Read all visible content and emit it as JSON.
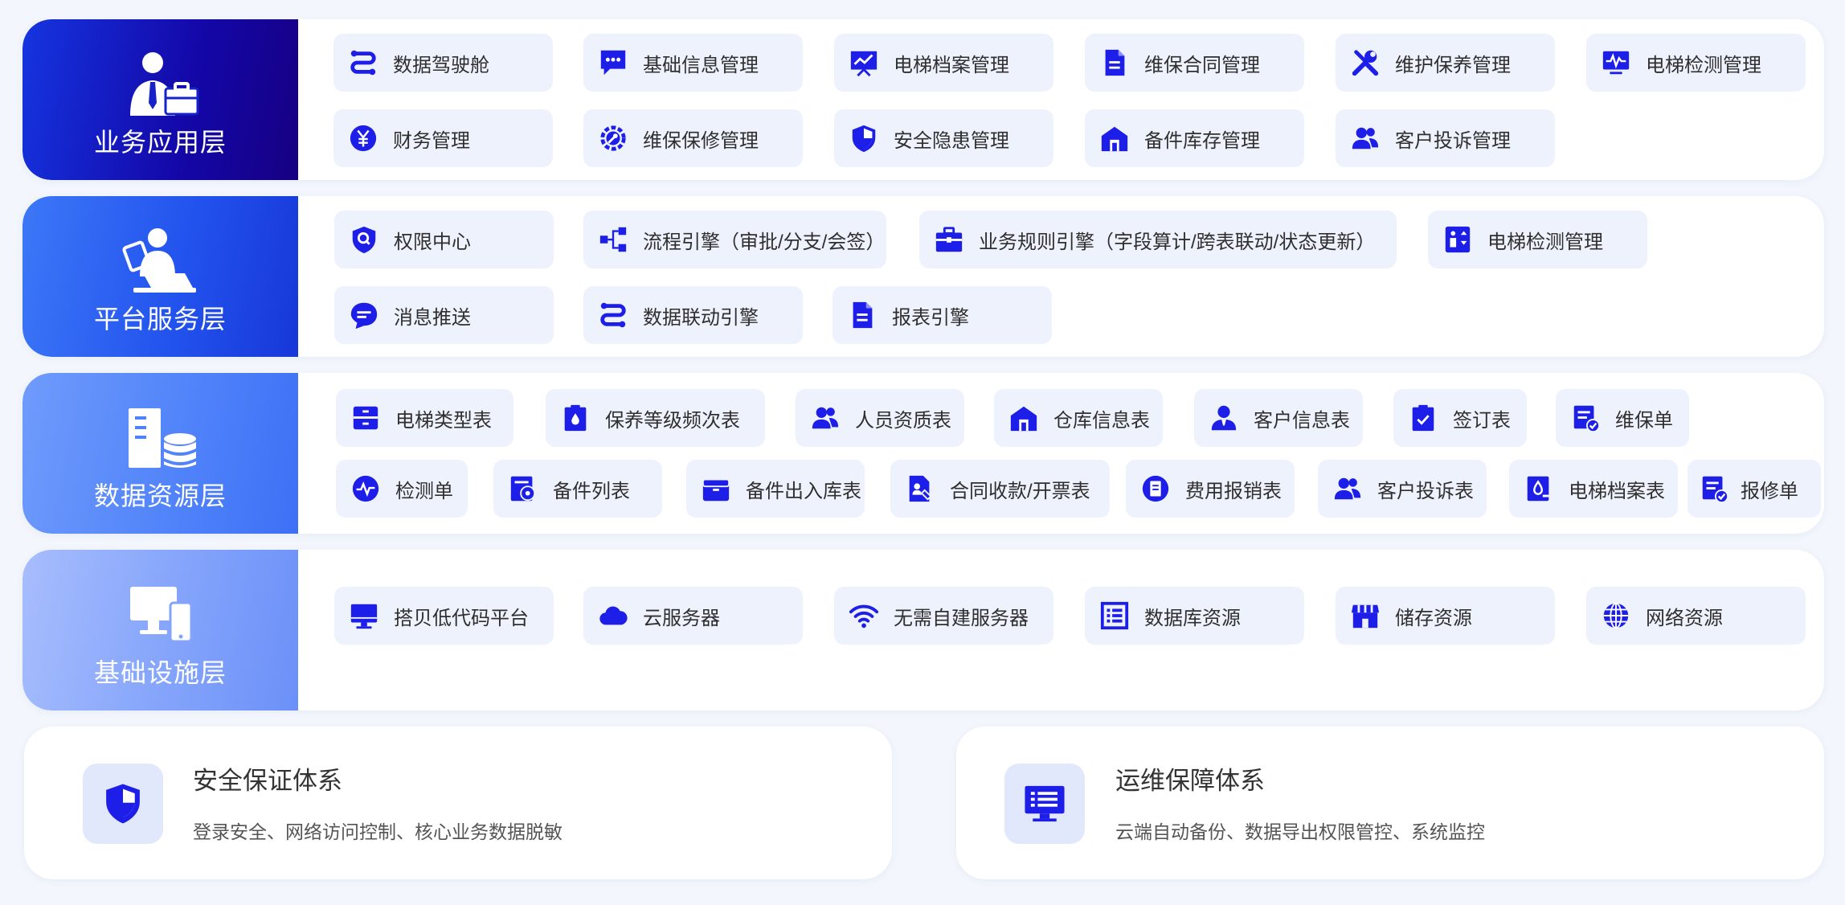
{
  "colors": {
    "accent": "#1d1ee8",
    "pill_bg": "#eef2fd",
    "page_bg": "#f3f6fc"
  },
  "layers": [
    {
      "label": "业务应用层",
      "items": [
        {
          "label": "数据驾驶舱",
          "icon": "route-icon"
        },
        {
          "label": "基础信息管理",
          "icon": "chat-dots-icon"
        },
        {
          "label": "电梯档案管理",
          "icon": "presentation-chart-icon"
        },
        {
          "label": "维保合同管理",
          "icon": "document-icon"
        },
        {
          "label": "维护保养管理",
          "icon": "tools-icon"
        },
        {
          "label": "电梯检测管理",
          "icon": "monitor-pulse-icon"
        },
        {
          "label": "财务管理",
          "icon": "yen-circle-icon"
        },
        {
          "label": "维保保修管理",
          "icon": "wrench-gear-icon"
        },
        {
          "label": "安全隐患管理",
          "icon": "shield-icon"
        },
        {
          "label": "备件库存管理",
          "icon": "warehouse-icon"
        },
        {
          "label": "客户投诉管理",
          "icon": "users-icon"
        }
      ]
    },
    {
      "label": "平台服务层",
      "items": [
        {
          "label": "权限中心",
          "icon": "shield-search-icon"
        },
        {
          "label": "流程引擎（审批/分支/会签）",
          "icon": "flow-branch-icon"
        },
        {
          "label": "业务规则引擎（字段算计/跨表联动/状态更新）",
          "icon": "briefcase-icon"
        },
        {
          "label": "电梯检测管理",
          "icon": "elevator-icon"
        },
        {
          "label": "消息推送",
          "icon": "message-bubble-icon"
        },
        {
          "label": "数据联动引擎",
          "icon": "route-icon"
        },
        {
          "label": "报表引擎",
          "icon": "document-icon"
        }
      ]
    },
    {
      "label": "数据资源层",
      "items": [
        {
          "label": "电梯类型表",
          "icon": "cabinet-icon"
        },
        {
          "label": "保养等级频次表",
          "icon": "clipboard-drop-icon"
        },
        {
          "label": "人员资质表",
          "icon": "users-icon"
        },
        {
          "label": "仓库信息表",
          "icon": "warehouse-icon"
        },
        {
          "label": "客户信息表",
          "icon": "customer-icon"
        },
        {
          "label": "签订表",
          "icon": "clipboard-check-icon"
        },
        {
          "label": "维保单",
          "icon": "form-check-icon"
        },
        {
          "label": "检测单",
          "icon": "pulse-circle-icon"
        },
        {
          "label": "备件列表",
          "icon": "parts-list-icon"
        },
        {
          "label": "备件出入库表",
          "icon": "box-icon"
        },
        {
          "label": "合同收款/开票表",
          "icon": "contract-icon"
        },
        {
          "label": "费用报销表",
          "icon": "receipt-circle-icon"
        },
        {
          "label": "客户投诉表",
          "icon": "users-icon"
        },
        {
          "label": "电梯档案表",
          "icon": "archive-icon"
        },
        {
          "label": "报修单",
          "icon": "form-check-icon"
        }
      ]
    },
    {
      "label": "基础设施层",
      "items": [
        {
          "label": "搭贝低代码平台",
          "icon": "desktop-icon"
        },
        {
          "label": "云服务器",
          "icon": "cloud-icon"
        },
        {
          "label": "无需自建服务器",
          "icon": "wifi-icon"
        },
        {
          "label": "数据库资源",
          "icon": "list-box-icon"
        },
        {
          "label": "储存资源",
          "icon": "store-icon"
        },
        {
          "label": "网络资源",
          "icon": "globe-icon"
        }
      ]
    }
  ],
  "bottom": [
    {
      "title": "安全保证体系",
      "desc": "登录安全、网络访问控制、核心业务数据脱敏",
      "icon": "shield-icon"
    },
    {
      "title": "运维保障体系",
      "desc": "云端自动备份、数据导出权限管控、系统监控",
      "icon": "monitor-list-icon"
    }
  ]
}
